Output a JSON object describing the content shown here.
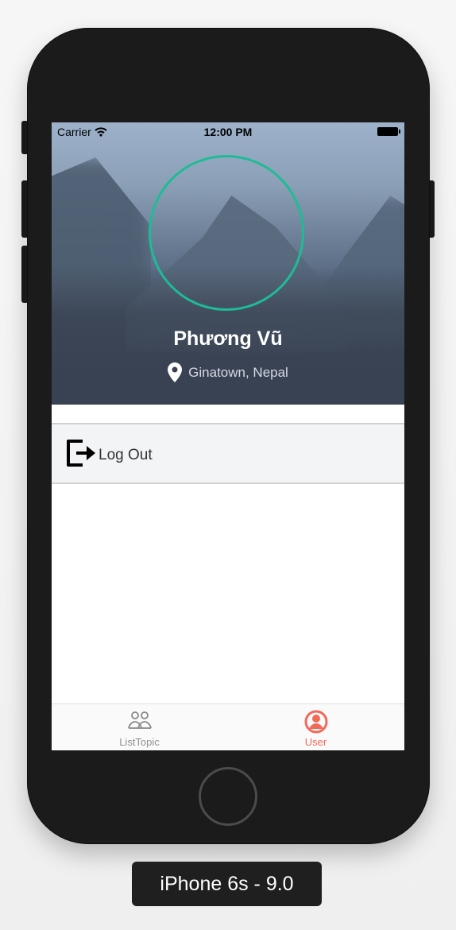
{
  "status_bar": {
    "carrier": "Carrier",
    "time": "12:00 PM",
    "wifi_icon": "wifi-icon",
    "battery_icon": "battery-icon"
  },
  "profile": {
    "name": "Phương Vũ",
    "location": "Ginatown, Nepal",
    "location_icon": "map-pin-icon",
    "avatar_ring_color": "#1EBC96"
  },
  "menu": {
    "logout_label": "Log Out",
    "logout_icon": "logout-icon"
  },
  "tabbar": {
    "items": [
      {
        "label": "ListTopic",
        "icon": "users-icon",
        "active": false
      },
      {
        "label": "User",
        "icon": "user-avatar-icon",
        "active": true
      }
    ],
    "active_color": "#F26A58",
    "inactive_color": "#8F8F8F"
  },
  "device": {
    "label": "iPhone 6s - 9.0"
  }
}
